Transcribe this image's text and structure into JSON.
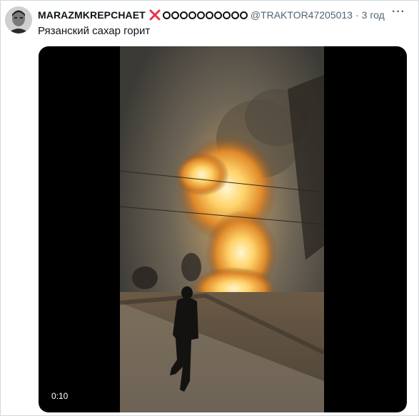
{
  "tweet": {
    "author_name": "MARAZMKREPCHAET",
    "handle": "@TRAKTOR47205013",
    "separator": "·",
    "time": "3 год",
    "more_label": "···",
    "text": "Рязанский сахар горит",
    "badge_icon": "red-x-icon",
    "name_glyph_count": 10
  },
  "media": {
    "type": "video",
    "duration": "0:10",
    "scene": "night-fire-explosion"
  },
  "colors": {
    "x_mark": "#e8344a",
    "secondary_text": "#536471",
    "border": "#cfd9de"
  }
}
